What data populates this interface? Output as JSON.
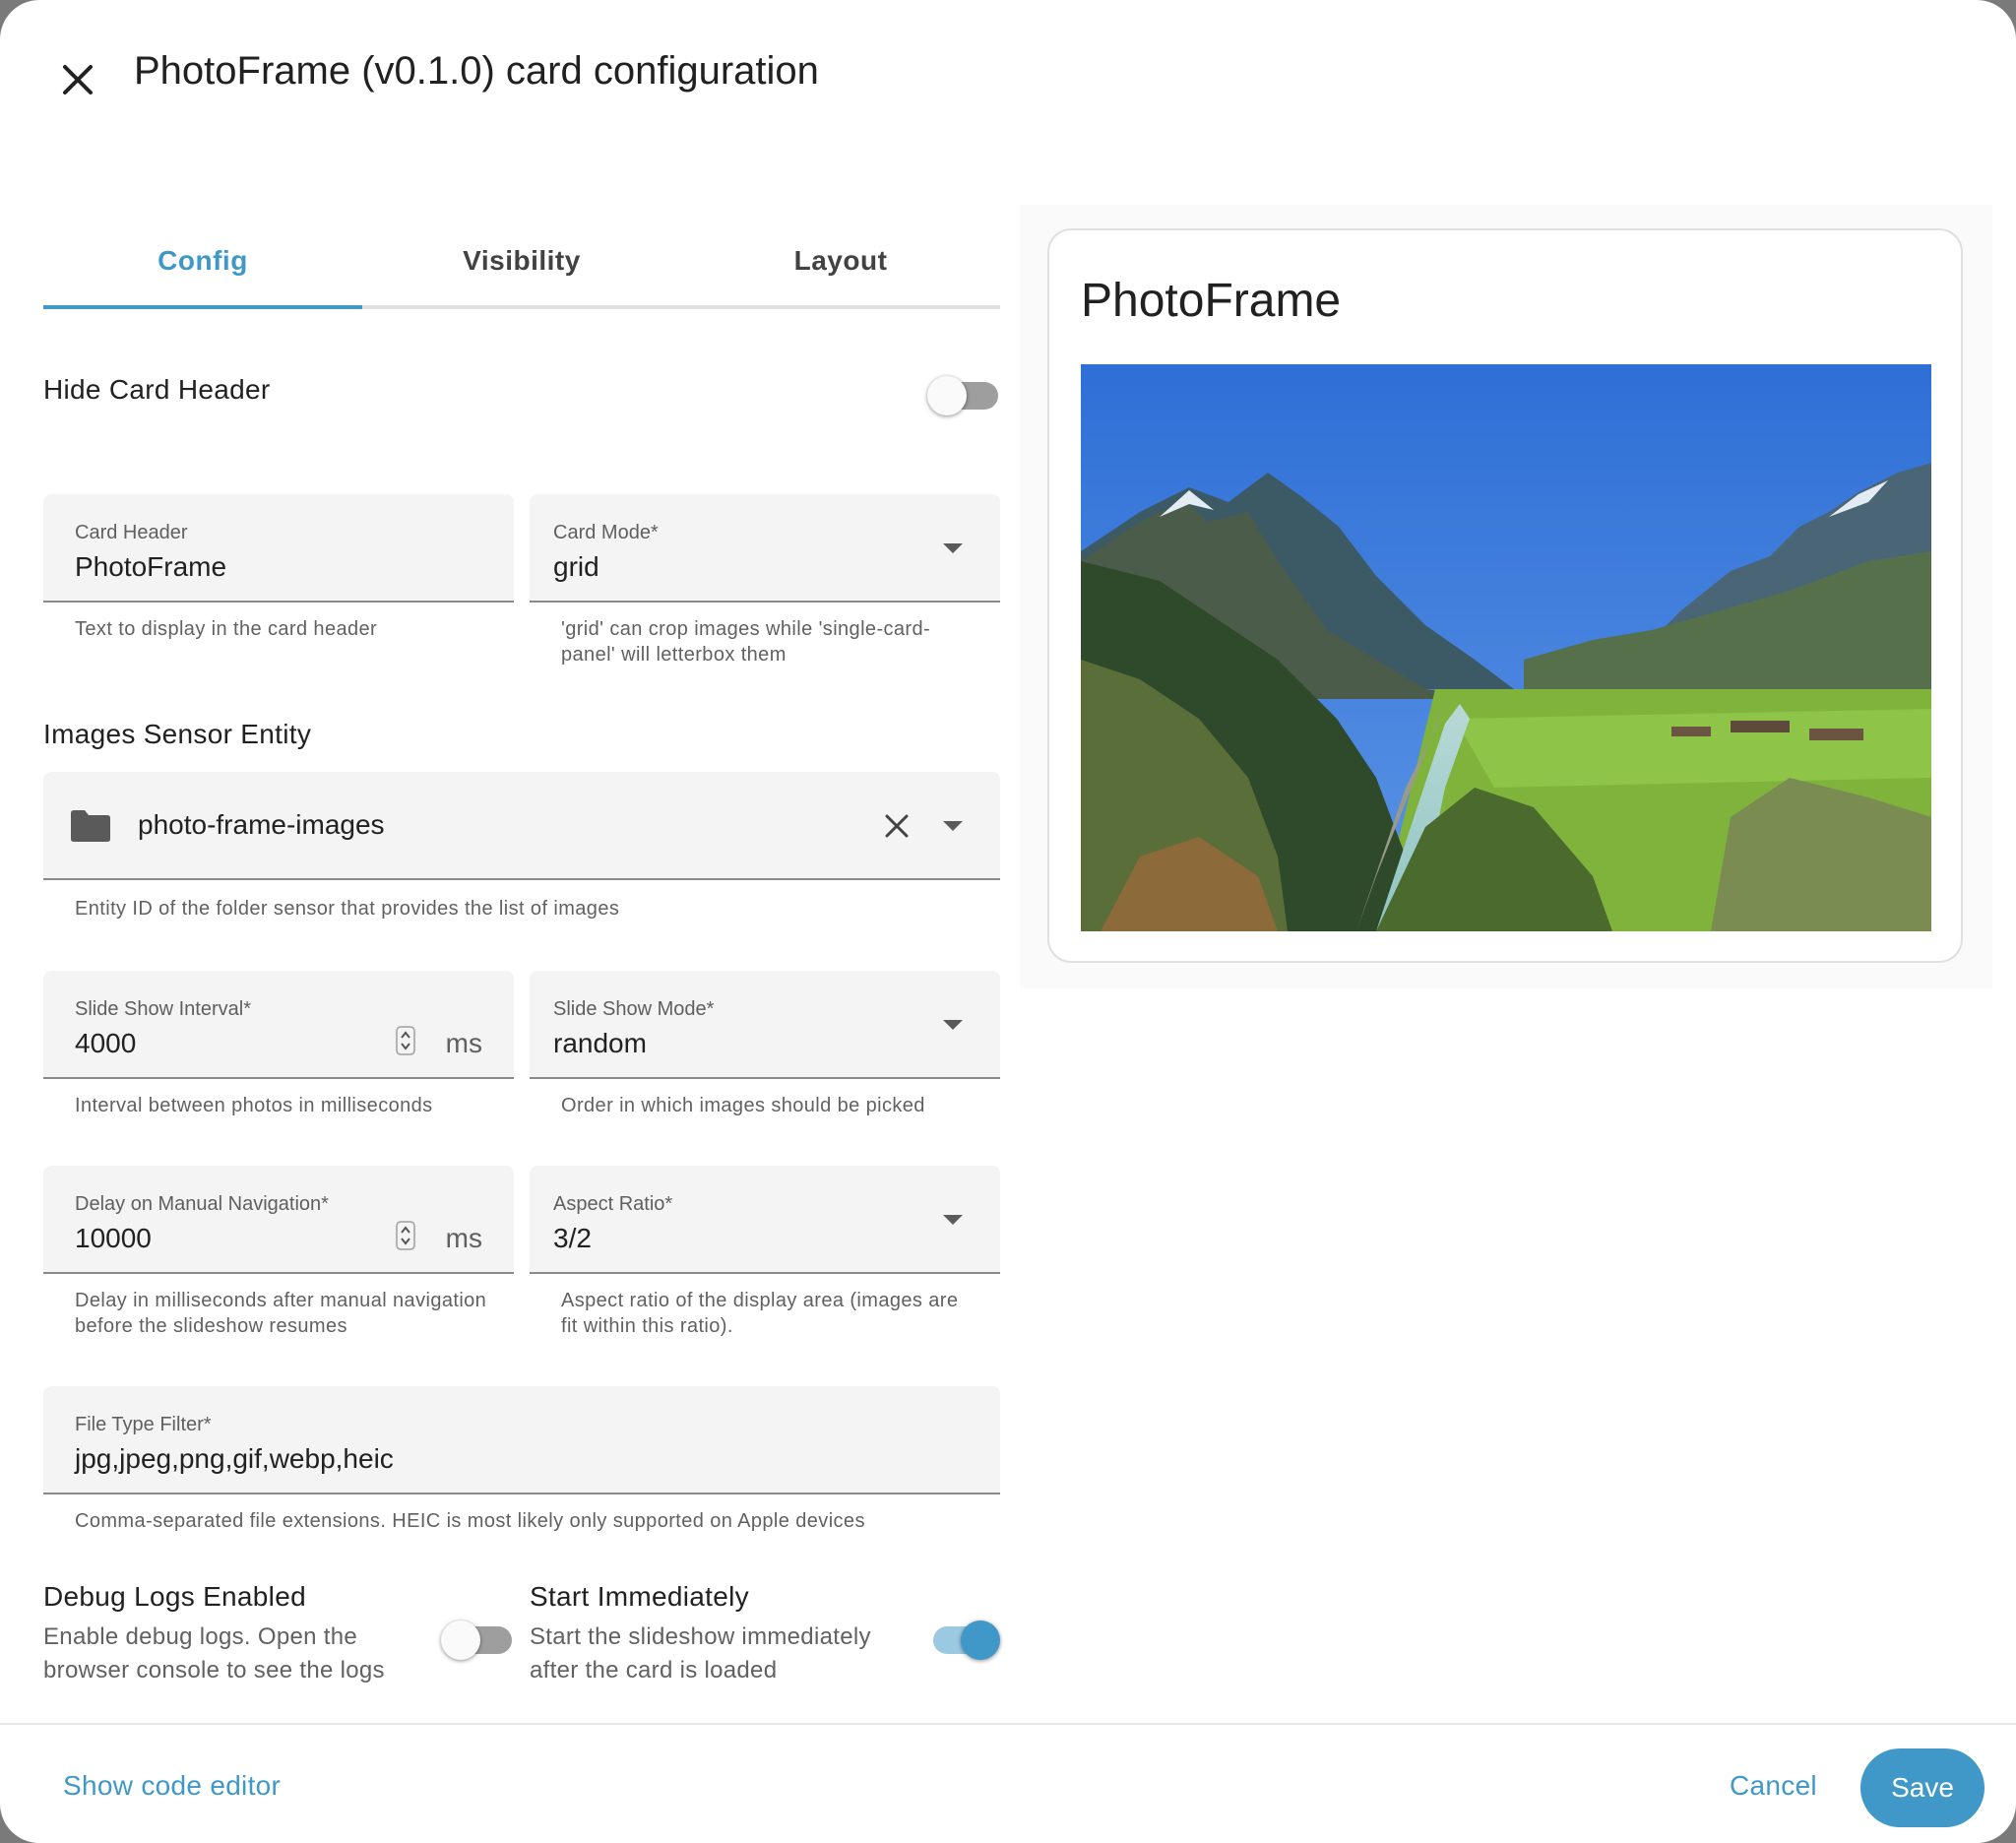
{
  "dialog": {
    "title": "PhotoFrame (v0.1.0) card configuration"
  },
  "tabs": [
    {
      "label": "Config"
    },
    {
      "label": "Visibility"
    },
    {
      "label": "Layout"
    }
  ],
  "hide_header": {
    "label": "Hide Card Header",
    "checked": false
  },
  "card_header": {
    "label": "Card Header",
    "value": "PhotoFrame",
    "helper": "Text to display in the card header"
  },
  "card_mode": {
    "label": "Card Mode*",
    "value": "grid",
    "helper": "'grid' can crop images while 'single-card-panel' will letterbox them"
  },
  "images_sensor": {
    "section_label": "Images Sensor Entity",
    "value": "photo-frame-images",
    "helper": "Entity ID of the folder sensor that provides the list of images"
  },
  "interval": {
    "label": "Slide Show Interval*",
    "value": "4000",
    "suffix": "ms",
    "helper": "Interval between photos in milliseconds"
  },
  "slide_mode": {
    "label": "Slide Show Mode*",
    "value": "random",
    "helper": "Order in which images should be picked"
  },
  "delay": {
    "label": "Delay on Manual Navigation*",
    "value": "10000",
    "suffix": "ms",
    "helper": "Delay in milliseconds after manual navigation before the slideshow resumes"
  },
  "aspect": {
    "label": "Aspect Ratio*",
    "value": "3/2",
    "helper": "Aspect ratio of the display area (images are fit within this ratio)."
  },
  "file_filter": {
    "label": "File Type Filter*",
    "value": "jpg,jpeg,png,gif,webp,heic",
    "helper": "Comma-separated file extensions. HEIC is most likely only supported on Apple devices"
  },
  "debug": {
    "title": "Debug Logs Enabled",
    "description": "Enable debug logs. Open the browser console to see the logs",
    "checked": false
  },
  "start": {
    "title": "Start Immediately",
    "description": "Start the slideshow immediately after the card is loaded",
    "checked": true
  },
  "preview": {
    "card_title": "PhotoFrame"
  },
  "footer": {
    "code_editor": "Show code editor",
    "cancel": "Cancel",
    "save": "Save"
  },
  "colors": {
    "accent": "#3f98c8",
    "field_bg": "#f4f4f4"
  },
  "icons": {
    "close": "close-icon",
    "folder": "folder-icon",
    "clear": "clear-icon",
    "dropdown": "chevron-down-icon"
  }
}
